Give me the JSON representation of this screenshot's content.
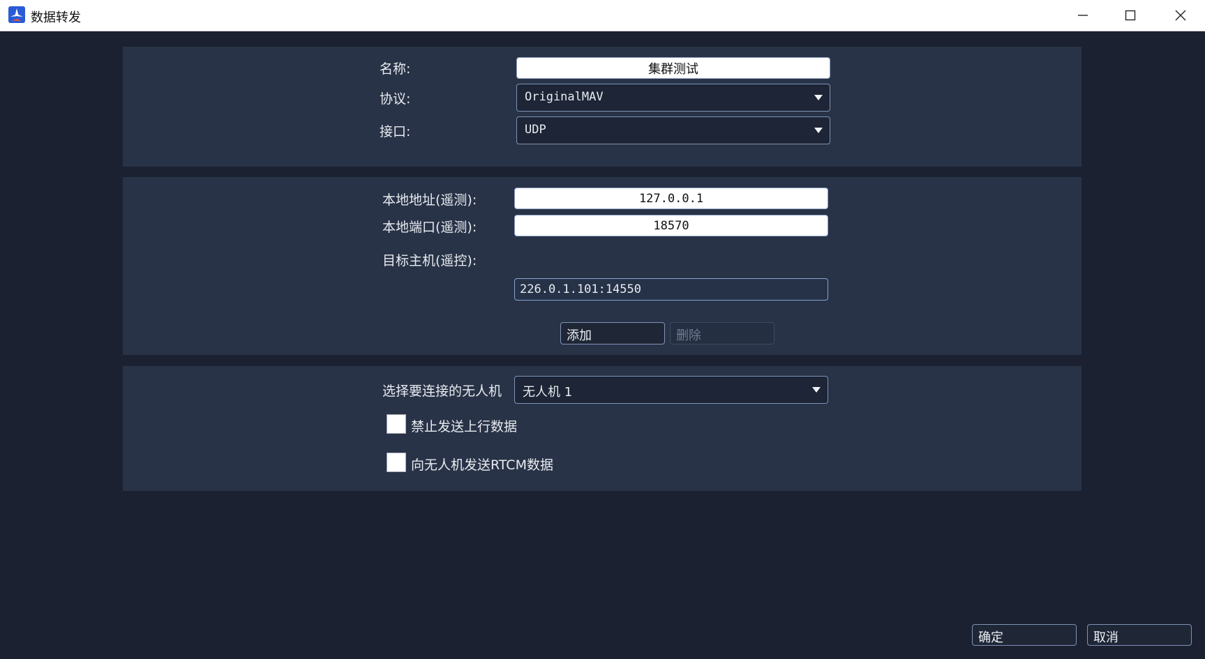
{
  "window": {
    "title": "数据转发"
  },
  "form": {
    "name_label": "名称:",
    "name_value": "集群测试",
    "protocol_label": "协议:",
    "protocol_value": "OriginalMAV",
    "interface_label": "接口:",
    "interface_value": "UDP",
    "local_addr_label": "本地地址(遥测):",
    "local_addr_value": "127.0.0.1",
    "local_port_label": "本地端口(遥测):",
    "local_port_value": "18570",
    "target_host_label": "目标主机(遥控):",
    "target_host_value": "226.0.1.101:14550",
    "add_label": "添加",
    "delete_label": "删除",
    "select_uav_label": "选择要连接的无人机",
    "select_uav_value": "无人机 1",
    "disable_uplink_label": "禁止发送上行数据",
    "send_rtcm_label": "向无人机发送RTCM数据"
  },
  "footer": {
    "ok_label": "确定",
    "cancel_label": "取消"
  }
}
